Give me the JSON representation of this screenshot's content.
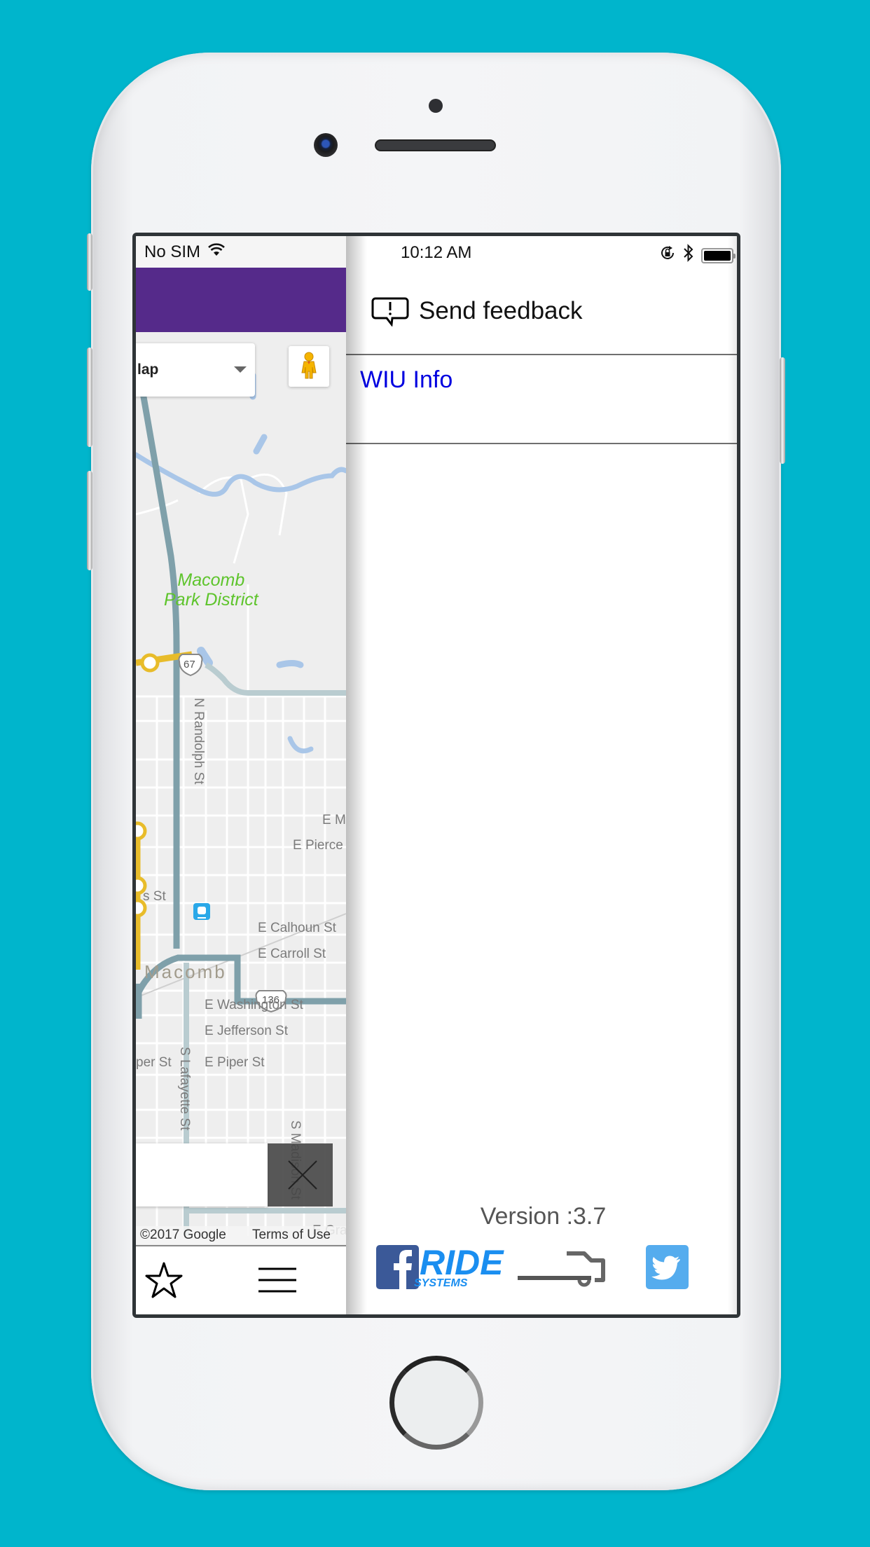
{
  "status_bar": {
    "carrier": "No SIM",
    "time": "10:12 AM",
    "icons": [
      "wifi-icon",
      "rotation-lock-icon",
      "bluetooth-icon",
      "battery-icon"
    ],
    "battery_level": 1.0
  },
  "app": {
    "header_color": "#552a8a",
    "map": {
      "map_type_selected": "Map",
      "map_type_visible_text": "lap",
      "park_label_line1": "Macomb",
      "park_label_line2": "Park District",
      "town_label": "Macomb",
      "route_shields": [
        "67",
        "136"
      ],
      "street_labels": {
        "randolph": "N Randolph St",
        "em": "E M",
        "pierce": "E Pierce",
        "s_st": "s St",
        "calhoun": "E Calhoun St",
        "carroll": "E Carroll St",
        "washington": "E Washington St",
        "jefferson": "E Jefferson St",
        "piper_left": "per St",
        "piper": "E Piper St",
        "lafayette": "S Lafayette St",
        "madison": "S Madison St",
        "gra": "E Gra"
      },
      "attribution": "©2017 Google",
      "terms": "Terms of Use",
      "route_color": "#e8bc2a",
      "road_color": "#7fa0aa"
    },
    "bottom_nav": {
      "favorites_icon": "star-icon",
      "menu_icon": "hamburger-menu-icon"
    }
  },
  "drawer": {
    "items": [
      {
        "icon": "feedback-icon",
        "label": "Send feedback"
      },
      {
        "label": "WIU Info",
        "link_color": "#0000e0"
      }
    ],
    "version": "Version :3.7",
    "footer": {
      "facebook": "facebook-icon",
      "brand_top": "RIDE",
      "brand_bottom": "SYSTEMS",
      "brand_color": "#1a8ef0",
      "twitter": "twitter-icon"
    }
  }
}
